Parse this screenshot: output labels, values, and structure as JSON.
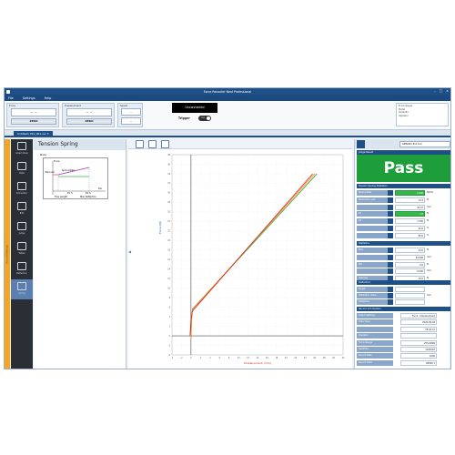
{
  "app": {
    "title": "Force Recorder Next Professional",
    "menu": [
      "File",
      "Settings",
      "Help"
    ],
    "window_buttons": [
      "–",
      "□",
      "✕"
    ]
  },
  "ribbon": {
    "force": {
      "label": "Force",
      "value": "--  --",
      "zero": "ZERO"
    },
    "displacement": {
      "label": "Displacement",
      "value": "--  --",
      "zero": "ZERO"
    },
    "speed": {
      "label": "Speed",
      "value1": "--",
      "value2": "--"
    },
    "status": "Unconnected",
    "trigger_label": "Trigger",
    "trigger_state": "OFF",
    "record_info": [
      "Force Gauge",
      "Model",
      "Serial No.",
      "Operator"
    ]
  },
  "doc_tab": "Untitled1 CSV_001.csv ✕",
  "left_strip_label": "Record Settings",
  "sidebar": [
    {
      "label": "Graph View",
      "icon": "graph-view-icon"
    },
    {
      "label": "Data",
      "icon": "data-icon"
    },
    {
      "label": "Simulation",
      "icon": "simulation-icon"
    },
    {
      "label": "Edit",
      "icon": "edit-icon"
    },
    {
      "label": "Judge",
      "icon": "judge-icon"
    },
    {
      "label": "Tables",
      "icon": "tables-icon"
    },
    {
      "label": "Deflection",
      "icon": "deflection-icon"
    },
    {
      "label": "Spring",
      "icon": "spring-icon"
    }
  ],
  "panel": {
    "title": "Tension Spring",
    "note_label": "Note",
    "diagram": {
      "force_label": "Force",
      "bar_load": "Bar Load",
      "spring_rate": "Spring Rate",
      "dis": "Dis",
      "p1": "P1 %",
      "p2": "P2 %",
      "free_length": "Free Length",
      "max_deflection": "Max Deflection"
    }
  },
  "chart_data": {
    "type": "line",
    "title": "",
    "xlabel": "Displacement (mm)",
    "ylabel": "Force (N)",
    "xlim": [
      -4,
      32
    ],
    "ylim": [
      -4,
      38
    ],
    "x_ticks": [
      "-4",
      "-2",
      "0",
      "2",
      "4",
      "6",
      "8",
      "10",
      "12",
      "14",
      "16",
      "18",
      "20",
      "22",
      "24",
      "26",
      "28",
      "30",
      "32"
    ],
    "y_ticks": [
      "-4",
      "-2",
      "0",
      "2",
      "4",
      "6",
      "8",
      "10",
      "12",
      "14",
      "16",
      "18",
      "20",
      "22",
      "24",
      "26",
      "28",
      "30",
      "32",
      "34",
      "36",
      "38"
    ],
    "grid": true,
    "series": [
      {
        "color": "#2ca02c",
        "x": [
          0,
          0.1,
          0.3,
          26.5
        ],
        "y": [
          -0.5,
          3,
          5.6,
          34
        ]
      },
      {
        "color": "#ff7f0e",
        "x": [
          0,
          0.1,
          0.3,
          26.0
        ],
        "y": [
          -0.5,
          3.1,
          5.5,
          34
        ]
      },
      {
        "color": "#d62728",
        "x": [
          -0.2,
          0,
          0.3,
          25.6
        ],
        "y": [
          0,
          3.5,
          5.2,
          34
        ]
      }
    ]
  },
  "right_panel": {
    "select": "RMN001 Ext Coil",
    "judge_header": "Judge Result",
    "pass": "Pass",
    "spring_header": "Tension Spring Statistics",
    "spring_rows": [
      {
        "label": "Spring Rate",
        "value": "1.000",
        "unit": "N/mm",
        "green": true
      },
      {
        "label": "Maximum Load",
        "value": "34.3",
        "unit": "N",
        "green": false
      },
      {
        "label": "",
        "value": "34.07",
        "unit": "mm",
        "green": false
      },
      {
        "label": "P1",
        "value": "7.0",
        "unit": "N",
        "green": true
      },
      {
        "label": "P2",
        "value": "7.000",
        "unit": "N",
        "green": false
      },
      {
        "label": "",
        "value": "40.0",
        "unit": "%",
        "green": false
      },
      {
        "label": "",
        "value": "80.0",
        "unit": "%",
        "green": false
      }
    ],
    "stats_header": "Statistics",
    "stats_rows": [
      {
        "label": "Max",
        "value": "34.0",
        "unit": "N"
      },
      {
        "label": "",
        "value": "34.000",
        "unit": "mm"
      },
      {
        "label": "Min",
        "value": "0.0",
        "unit": "N"
      },
      {
        "label": "",
        "value": "0.000",
        "unit": "mm"
      },
      {
        "label": "Average",
        "value": "19.0",
        "unit": "N"
      }
    ],
    "deflection_header": "Deflection",
    "deflection_rows": [
      {
        "label": "Target",
        "value": "",
        "unit": ""
      },
      {
        "label": "Deflection Value",
        "value": "",
        "unit": "mm"
      },
      {
        "label": "Deflection",
        "value": "",
        "unit": ""
      }
    ],
    "record_header": "Record Information",
    "record_rows": [
      {
        "label": "Graph Settings",
        "value": "Force - Displacement"
      },
      {
        "label": "Date Time",
        "value": "2020-09-04"
      },
      {
        "label": "",
        "value": "15:02:41"
      },
      {
        "label": "Operator",
        "value": ""
      },
      {
        "label": "Force Gauge",
        "value": "ZTS-500N"
      },
      {
        "label": "Serial No.",
        "value": "1234567"
      },
      {
        "label": "Record Rate",
        "value": "1000"
      },
      {
        "label": "Record Data",
        "value": "08360 7"
      }
    ]
  }
}
